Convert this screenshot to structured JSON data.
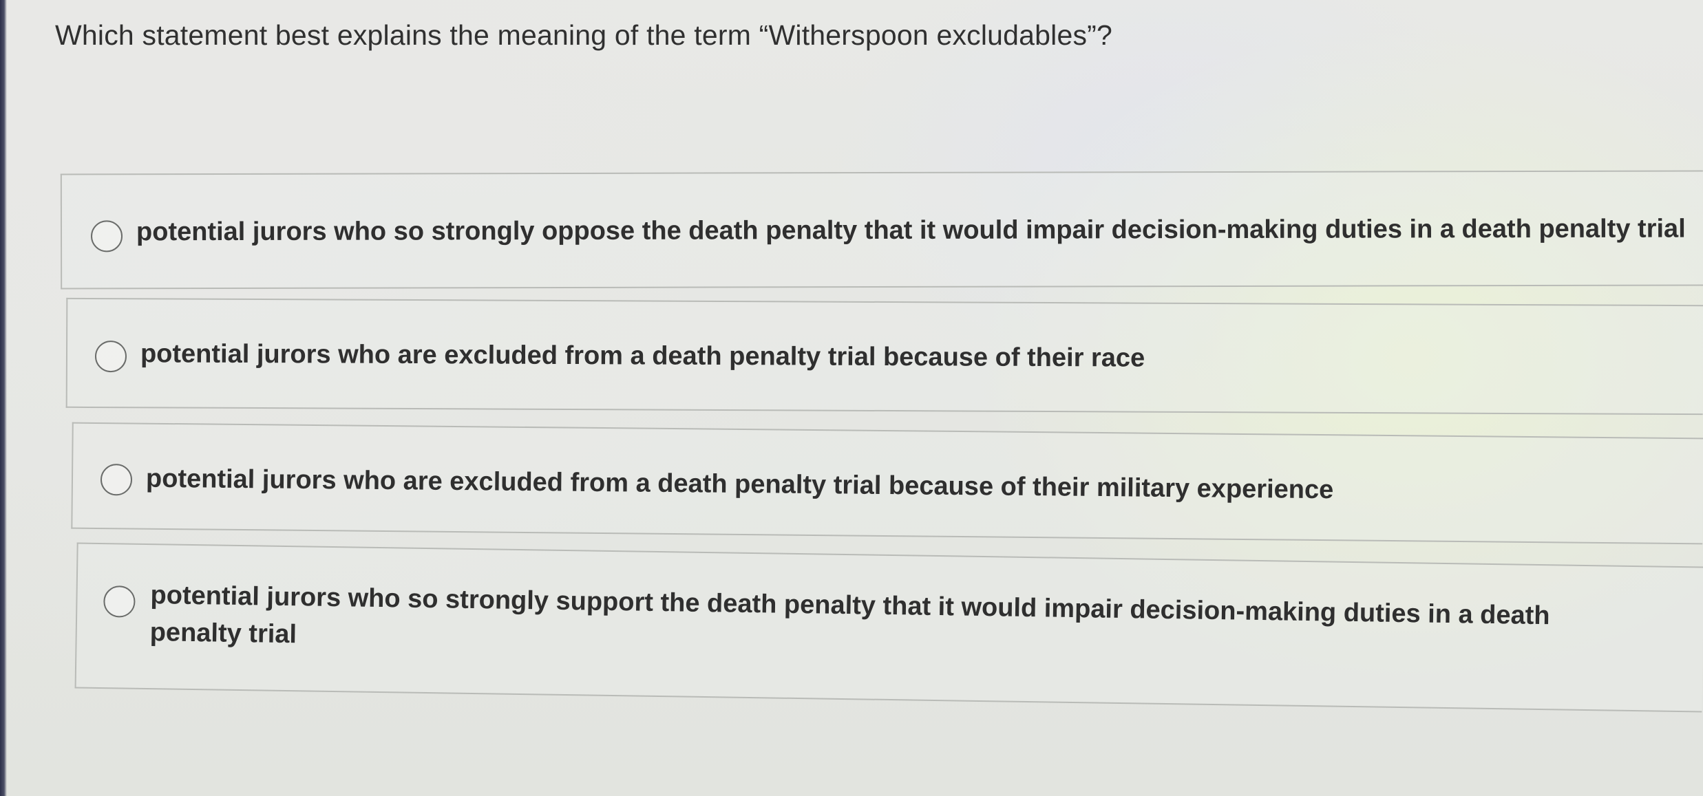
{
  "question": {
    "text": "Which statement best explains the meaning of the term “Witherspoon excludables”?"
  },
  "options": [
    {
      "label": "potential jurors who so strongly oppose the death penalty that it would impair decision-making duties in a death penalty trial",
      "selected": false
    },
    {
      "label": "potential jurors who are excluded from a death penalty trial because of their race",
      "selected": false
    },
    {
      "label": "potential jurors who are excluded from a death penalty trial because of their military experience",
      "selected": false
    },
    {
      "label": "potential jurors who so strongly support the death penalty that it would impair decision-making duties in a death penalty trial",
      "selected": false
    }
  ]
}
